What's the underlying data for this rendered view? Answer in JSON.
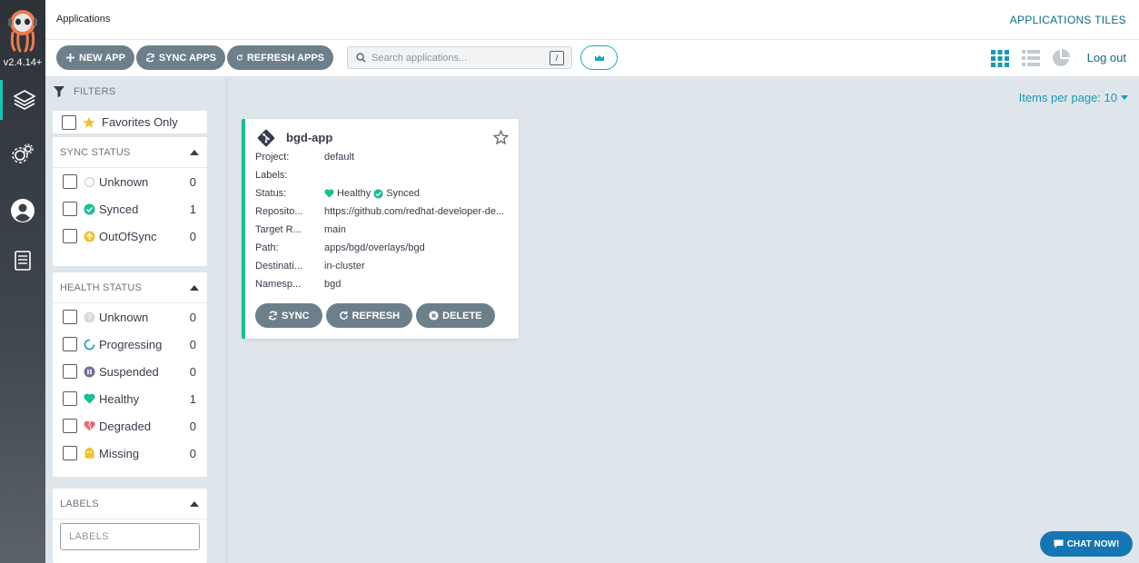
{
  "nav": {
    "version": "v2.4.14+",
    "items": [
      {
        "name": "applications",
        "active": true
      },
      {
        "name": "settings",
        "active": false
      },
      {
        "name": "user-info",
        "active": false
      },
      {
        "name": "documentation",
        "active": false
      }
    ]
  },
  "header": {
    "title": "Applications",
    "view_mode": "APPLICATIONS TILES"
  },
  "toolbar": {
    "new_app": "NEW APP",
    "sync_apps": "SYNC APPS",
    "refresh_apps": "REFRESH APPS",
    "search_placeholder": "Search applications...",
    "search_shortcut": "/",
    "logout": "Log out"
  },
  "filters": {
    "title": "FILTERS",
    "favorites_only": "Favorites Only",
    "sync_status": {
      "title": "SYNC STATUS",
      "items": [
        {
          "label": "Unknown",
          "count": "0"
        },
        {
          "label": "Synced",
          "count": "1"
        },
        {
          "label": "OutOfSync",
          "count": "0"
        }
      ]
    },
    "health_status": {
      "title": "HEALTH STATUS",
      "items": [
        {
          "label": "Unknown",
          "count": "0"
        },
        {
          "label": "Progressing",
          "count": "0"
        },
        {
          "label": "Suspended",
          "count": "0"
        },
        {
          "label": "Healthy",
          "count": "1"
        },
        {
          "label": "Degraded",
          "count": "0"
        },
        {
          "label": "Missing",
          "count": "0"
        }
      ]
    },
    "labels": {
      "title": "LABELS",
      "placeholder": "LABELS"
    }
  },
  "main": {
    "items_per_page": "Items per page: 10",
    "app": {
      "name": "bgd-app",
      "rows": [
        {
          "key": "Project:",
          "value": "default"
        },
        {
          "key": "Labels:",
          "value": ""
        },
        {
          "key": "Status:",
          "health": "Healthy",
          "sync": "Synced"
        },
        {
          "key": "Reposito...",
          "value": "https://github.com/redhat-developer-de..."
        },
        {
          "key": "Target R...",
          "value": "main"
        },
        {
          "key": "Path:",
          "value": "apps/bgd/overlays/bgd"
        },
        {
          "key": "Destinati...",
          "value": "in-cluster"
        },
        {
          "key": "Namesp...",
          "value": "bgd"
        }
      ],
      "actions": {
        "sync": "SYNC",
        "refresh": "REFRESH",
        "delete": "DELETE"
      }
    }
  },
  "chat": "CHAT NOW!",
  "colors": {
    "healthy": "#18be94",
    "synced": "#18be94",
    "out_of_sync": "#f4c030",
    "degraded": "#e96d76",
    "accent": "#1c97b3",
    "button": "#6d7f8b"
  }
}
